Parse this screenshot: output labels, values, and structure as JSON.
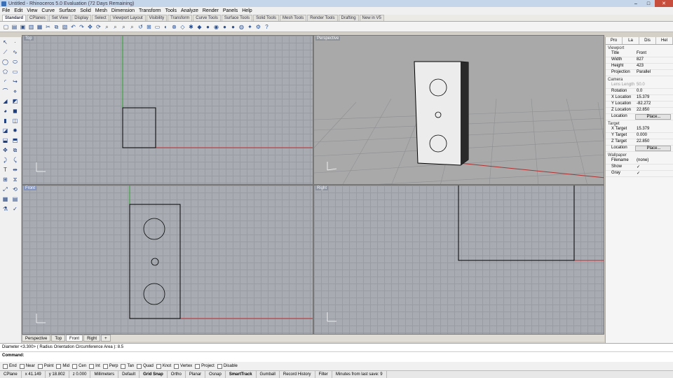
{
  "window": {
    "title": "Untitled - Rhinoceros 5.0 Evaluation (72 Days Remaining)"
  },
  "menu": [
    "File",
    "Edit",
    "View",
    "Curve",
    "Surface",
    "Solid",
    "Mesh",
    "Dimension",
    "Transform",
    "Tools",
    "Analyze",
    "Render",
    "Panels",
    "Help"
  ],
  "toolbar_tabs": [
    "Standard",
    "CPlanes",
    "Set View",
    "Display",
    "Select",
    "Viewport Layout",
    "Visibility",
    "Transform",
    "Curve Tools",
    "Surface Tools",
    "Solid Tools",
    "Mesh Tools",
    "Render Tools",
    "Drafting",
    "New in V5"
  ],
  "viewports": {
    "top": "Top",
    "perspective": "Perspective",
    "front": "Front",
    "right": "Right"
  },
  "viewport_tabs": [
    "Perspective",
    "Top",
    "Front",
    "Right"
  ],
  "panel": {
    "tabs": [
      "Pro",
      "La",
      "Dis",
      "Hel"
    ],
    "viewport_section": "Viewport",
    "viewport_rows": [
      [
        "Title",
        "Front"
      ],
      [
        "Width",
        "827"
      ],
      [
        "Height",
        "423"
      ],
      [
        "Projection",
        "Parallel"
      ]
    ],
    "camera_section": "Camera",
    "camera_rows": [
      [
        "Lens Length",
        "50.0"
      ],
      [
        "Rotation",
        "0.0"
      ],
      [
        "X Location",
        "15.379"
      ],
      [
        "Y Location",
        "-82.272"
      ],
      [
        "Z Location",
        "22.850"
      ],
      [
        "Location",
        "Place..."
      ]
    ],
    "target_section": "Target",
    "target_rows": [
      [
        "X Target",
        "15.379"
      ],
      [
        "Y Target",
        "0.000"
      ],
      [
        "Z Target",
        "22.850"
      ],
      [
        "Location",
        "Place..."
      ]
    ],
    "wallpaper_section": "Wallpaper",
    "wallpaper_rows": [
      [
        "Filename",
        "(none)"
      ],
      [
        "Show",
        "✓"
      ],
      [
        "Gray",
        "✓"
      ]
    ]
  },
  "command": {
    "history": "Diameter <3.300> ( Radius  Orientation  Circumference  Area ): 8.5",
    "prompt": "Command:"
  },
  "osnaps": [
    "End",
    "Near",
    "Point",
    "Mid",
    "Cen",
    "Int",
    "Perp",
    "Tan",
    "Quad",
    "Knot",
    "Vertex",
    "Project",
    "Disable"
  ],
  "status": {
    "cplane": "CPlane",
    "x": "x 41.149",
    "y": "y 18.802",
    "z": "z 0.000",
    "units": "Millimeters",
    "layer": "Default",
    "grid_snap": "Grid Snap",
    "ortho": "Ortho",
    "planar": "Planar",
    "osnap": "Osnap",
    "smarttrack": "SmartTrack",
    "gumball": "Gumball",
    "record_history": "Record History",
    "filter": "Filter",
    "save": "Minutes from last save: 9"
  },
  "colors": {
    "grid": "#a8acb2",
    "x_axis": "#c03030",
    "y_axis": "#30a030",
    "active_label": "#8496c0"
  }
}
